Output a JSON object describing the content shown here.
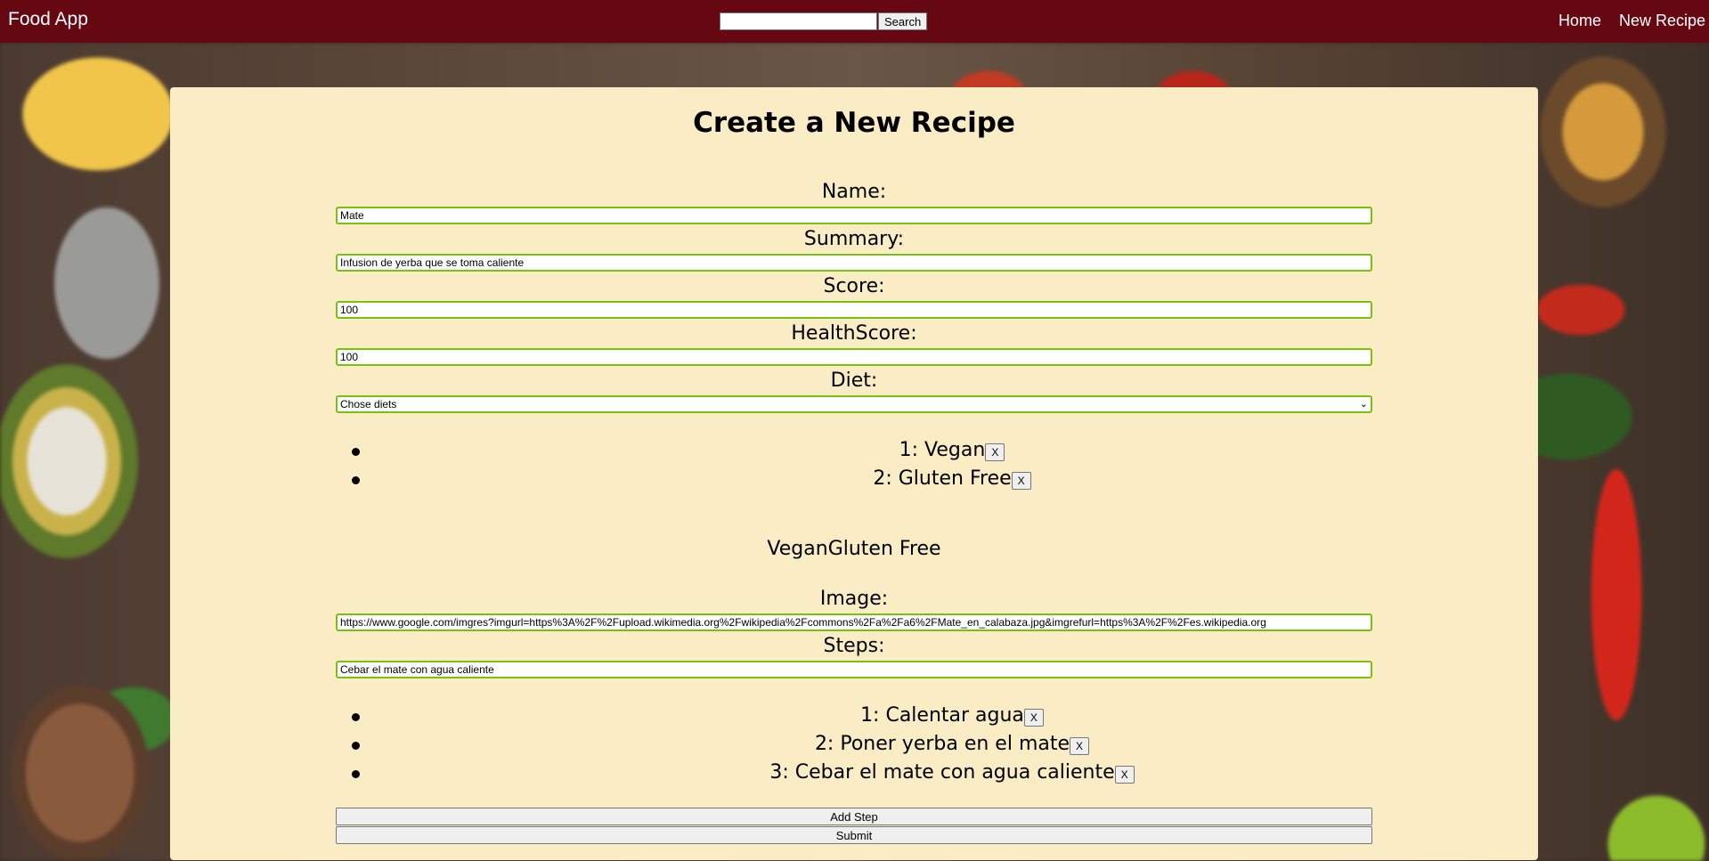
{
  "navbar": {
    "brand": "Food App",
    "search_button": "Search",
    "search_value": "",
    "links": [
      "Home",
      "New Recipe"
    ]
  },
  "form": {
    "title": "Create a New Recipe",
    "name_label": "Name:",
    "name_value": "Mate",
    "summary_label": "Summary:",
    "summary_value": "Infusion de yerba que se toma caliente",
    "score_label": "Score:",
    "score_value": "100",
    "healthscore_label": "HealthScore:",
    "healthscore_value": "100",
    "diet_label": "Diet:",
    "diet_select_value": "Chose diets",
    "diets": [
      "1: Vegan",
      "2: Gluten Free"
    ],
    "selected_diets_text": "VeganGluten Free",
    "image_label": "Image:",
    "image_value": "https://www.google.com/imgres?imgurl=https%3A%2F%2Fupload.wikimedia.org%2Fwikipedia%2Fcommons%2Fa%2Fa6%2FMate_en_calabaza.jpg&imgrefurl=https%3A%2F%2Fes.wikipedia.org",
    "steps_label": "Steps:",
    "steps_value": "Cebar el mate con agua caliente",
    "steps": [
      "1: Calentar agua",
      "2: Poner yerba en el mate",
      "3: Cebar el mate con agua caliente"
    ],
    "remove_label": "X",
    "add_step_button": "Add Step",
    "submit_button": "Submit"
  },
  "colors": {
    "navbar": "#660811",
    "card": "#faecc4",
    "field_border": "#79c10f"
  }
}
